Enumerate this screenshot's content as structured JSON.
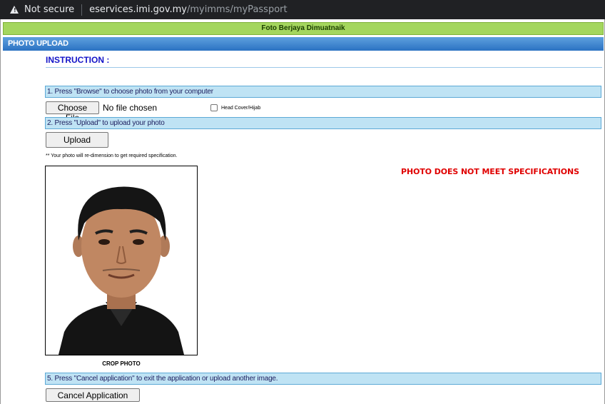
{
  "browser": {
    "security_label": "Not secure",
    "host": "eservices.imi.gov.my",
    "path": "/myimms/myPassport"
  },
  "page": {
    "success_message": "Foto Berjaya Dimuatnaik",
    "header_title": "PHOTO UPLOAD",
    "instruction_title": "INSTRUCTION :",
    "steps": [
      "1. Press \"Browse\" to choose photo from your computer",
      "2. Press \"Upload\" to upload your photo",
      "5. Press \"Cancel application\" to exit the application or upload another image."
    ],
    "choose_file_label": "Choose File",
    "no_file_text": "No file chosen",
    "head_cover_label": "Head Cover/Hijab",
    "head_cover_checked": false,
    "upload_label": "Upload",
    "note": "** Your photo will re-dimension to get required specification.",
    "crop_caption": "CROP PHOTO",
    "error_message": "PHOTO DOES NOT MEET SPECIFICATIONS",
    "cancel_label": "Cancel Application",
    "colors": {
      "success_bg": "#a4d65e",
      "header_bg": "#2b72c2",
      "step_bg": "#bfe3f4",
      "error_text": "#e00000",
      "instruction_text": "#1414c8"
    }
  }
}
